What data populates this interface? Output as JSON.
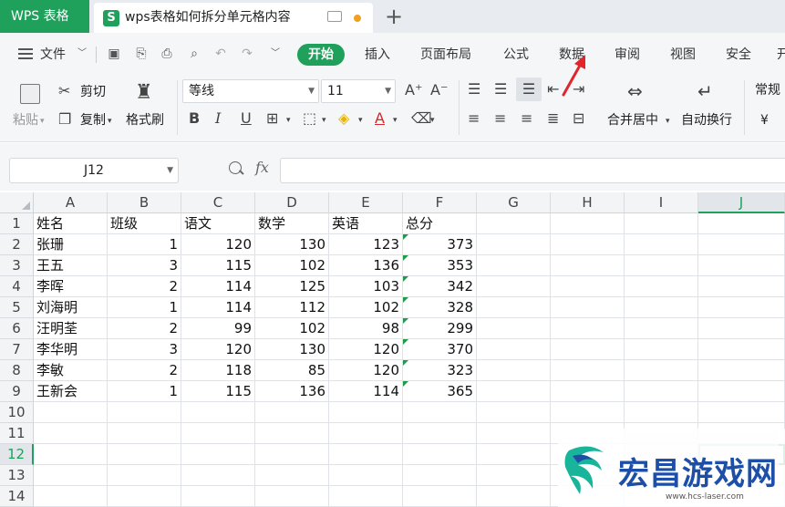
{
  "titlebar": {
    "app_tab": "WPS 表格",
    "doc_tab_icon": "S",
    "doc_title": "wps表格如何拆分单元格内容"
  },
  "menu": {
    "file": "文件",
    "items": [
      "开始",
      "插入",
      "页面布局",
      "公式",
      "数据",
      "审阅",
      "视图",
      "安全",
      "开"
    ],
    "active": "开始"
  },
  "ribbon": {
    "paste": "粘贴",
    "cut": "剪切",
    "copy": "复制",
    "format_painter": "格式刷",
    "font_name": "等线",
    "font_size": "11",
    "merge_center": "合并居中",
    "wrap_text": "自动换行",
    "number_format": "常规",
    "currency_symbol": "¥"
  },
  "formula_bar": {
    "cell_ref": "J12",
    "fx": "fx",
    "formula": ""
  },
  "sheet": {
    "columns": [
      "A",
      "B",
      "C",
      "D",
      "E",
      "F",
      "G",
      "H",
      "I",
      "J"
    ],
    "selected_column": "J",
    "selected_row": 12,
    "rows": [
      "1",
      "2",
      "3",
      "4",
      "5",
      "6",
      "7",
      "8",
      "9",
      "10",
      "11",
      "12",
      "13",
      "14"
    ],
    "header": [
      "姓名",
      "班级",
      "语文",
      "数学",
      "英语",
      "总分"
    ],
    "data": [
      [
        "张珊",
        "1",
        "120",
        "130",
        "123",
        "373"
      ],
      [
        "王五",
        "3",
        "115",
        "102",
        "136",
        "353"
      ],
      [
        "李晖",
        "2",
        "114",
        "125",
        "103",
        "342"
      ],
      [
        "刘海明",
        "1",
        "114",
        "112",
        "102",
        "328"
      ],
      [
        "汪明荃",
        "2",
        "99",
        "102",
        "98",
        "299"
      ],
      [
        "李华明",
        "3",
        "120",
        "130",
        "120",
        "370"
      ],
      [
        "李敏",
        "2",
        "118",
        "85",
        "120",
        "323"
      ],
      [
        "王新会",
        "1",
        "115",
        "136",
        "114",
        "365"
      ]
    ]
  },
  "watermark": {
    "text": "宏昌游戏网",
    "url": "www.hcs-laser.com"
  },
  "colors": {
    "accent": "#1fa05b",
    "annotation_arrow": "#e0262b"
  }
}
